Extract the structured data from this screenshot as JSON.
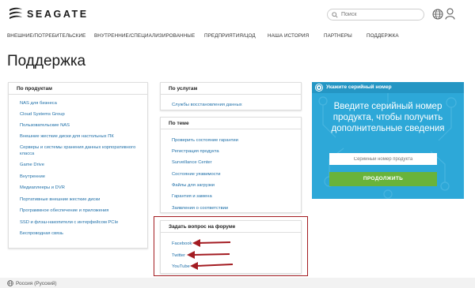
{
  "header": {
    "brand": "SEAGATE",
    "search_placeholder": "Поиск",
    "colors": {
      "accent_blue": "#2da8d8",
      "link": "#1e6fa8",
      "button_green": "#69b33b",
      "highlight_red": "#a31b21"
    }
  },
  "nav": {
    "items": [
      "ВНЕШНИЕ/ПОТРЕБИТЕЛЬСКИЕ",
      "ВНУТРЕННИЕ/СПЕЦИАЛИЗИРОВАННЫЕ",
      "ПРЕДПРИЯТИЯ/ЦОД",
      "НАША ИСТОРИЯ",
      "ПАРТНЕРЫ",
      "ПОДДЕРЖКА"
    ]
  },
  "page_title": "Поддержка",
  "products_panel": {
    "title": "По продуктам",
    "items": [
      "NAS для бизнеса",
      "Cloud Systems Group",
      "Пользовательские NAS",
      "Внешние жесткие диски для настольных ПК",
      "Серверы и системы хранения данных корпоративного",
      "класса",
      "Game Drive",
      "Внутренние",
      "Медиаплееры и DVR",
      "Портативные внешние жесткие диски",
      "Программное обеспечение и приложения",
      "SSD и флэш-накопители с интерфейсом PCIe",
      "Беспроводная связь"
    ]
  },
  "services_panel": {
    "title": "По услугам",
    "items": [
      "Службы восстановления данных"
    ]
  },
  "topics_panel": {
    "title": "По теме",
    "items": [
      "Проверить состояние гарантии",
      "Регистрация продукта",
      "Surveillance Center",
      "Состояние уязвимости",
      "Файлы для загрузки",
      "Гарантия и замена",
      "Заявления о соответствии"
    ]
  },
  "forum_panel": {
    "title": "Задать вопрос на форуме",
    "items": [
      "Facebook",
      "Twitter",
      "YouTube"
    ]
  },
  "serial_panel": {
    "title": "Укажите серийный номер",
    "text_line1": "Введите серийный номер",
    "text_line2": "продукта, чтобы получить",
    "text_line3": "дополнительные сведения",
    "input_placeholder": "Серийный номер продукта",
    "button_label": "ПРОДОЛЖИТЬ"
  },
  "footer": {
    "locale": "Россия (Русский)"
  }
}
